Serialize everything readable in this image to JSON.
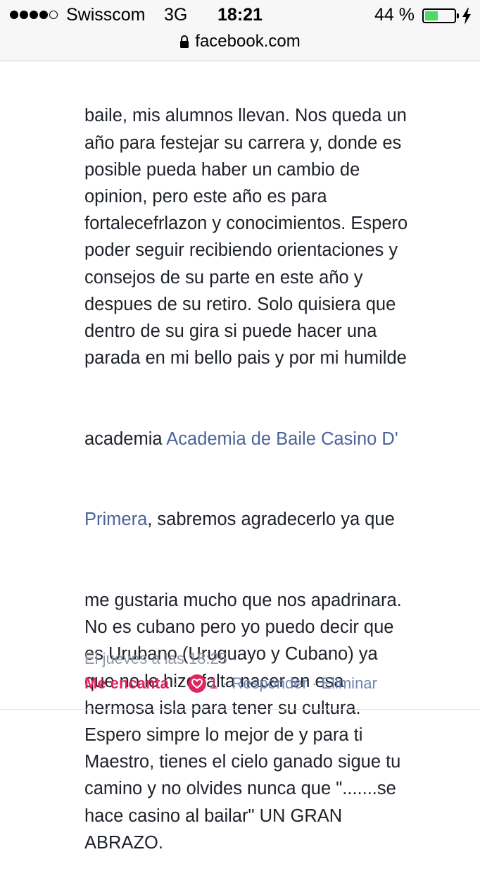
{
  "status_bar": {
    "carrier": "Swisscom",
    "network": "3G",
    "time": "18:21",
    "battery_percent": "44 %",
    "battery_level": 0.44,
    "signal_bars_filled": 4,
    "signal_bars_total": 5
  },
  "browser": {
    "url": "facebook.com"
  },
  "comment": {
    "lines": [
      "baile, mis alumnos llevan. Nos queda un",
      "año para festejar su carrera y, donde es",
      "posible pueda haber un cambio de",
      "opinion, pero este año es para",
      "fortalecefrlazon y conocimientos. Espero",
      "poder seguir recibiendo orientaciones y",
      "consejos de su parte en este año y",
      "despues de su retiro. Solo quisiera que",
      "dentro de su gira si puede hacer una",
      "parada en mi bello pais y por mi humilde"
    ],
    "line_before_link": "academia ",
    "link_part1": "Academia de Baile Casino D'",
    "link_part2": "Primera",
    "text_after_link": ", sabremos agradecerlo ya que",
    "lines_after": [
      "me gustaria mucho que nos apadrinara.",
      "No es cubano pero yo puedo decir que",
      "es Urubano (Uruguayo y Cubano) ya",
      "que no le hizo falta nacer en esa",
      "hermosa isla para tener su cultura.",
      "Espero simpre lo mejor de y para ti",
      "Maestro, tienes el cielo ganado sigue tu",
      "camino y no olvides nunca que \".......se",
      "hace casino al bailar\" UN GRAN",
      "ABRAZO."
    ],
    "timestamp": "El jueves a las 18:25 ·",
    "reaction_label": "Me encanta",
    "reaction_count": "1",
    "reply_label": "Responder",
    "delete_label": "Eliminar",
    "separator": " · "
  },
  "colors": {
    "link": "#4c639a",
    "love": "#e0245e",
    "meta": "#9197a3",
    "battery": "#4cd964"
  }
}
